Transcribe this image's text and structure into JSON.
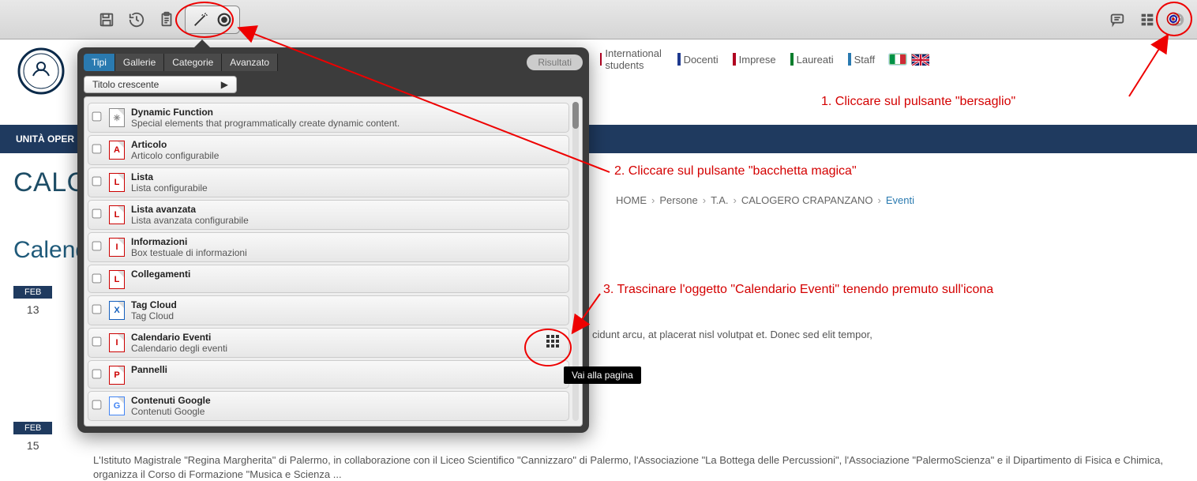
{
  "toolbar": {
    "icons": [
      "save",
      "history",
      "clipboard",
      "wand",
      "publish",
      "comment",
      "structure",
      "close",
      "target"
    ]
  },
  "nav": {
    "items": [
      {
        "label": "International students",
        "color": "#b00020"
      },
      {
        "label": "Docenti",
        "color": "#1f3a8f"
      },
      {
        "label": "Imprese",
        "color": "#b00020"
      },
      {
        "label": "Laureati",
        "color": "#0a7d2c"
      },
      {
        "label": "Staff",
        "color": "#2a7ab0"
      }
    ]
  },
  "blue_bar": "UNITÀ OPER",
  "big_title": "CALOG",
  "calendar_title": "Calenda",
  "feb_label": "FEB",
  "feb_days": [
    "13",
    "15"
  ],
  "breadcrumbs": [
    "HOME",
    "Persone",
    "T.A.",
    "CALOGERO CRAPANZANO"
  ],
  "breadcrumbs_current": "Eventi",
  "paragraph": "cidunt arcu, at placerat nisl volutpat et. Donec sed elit tempor,",
  "bottom_paragraph": "L'Istituto Magistrale \"Regina Margherita\" di Palermo, in collaborazione con il Liceo Scientifico \"Cannizzaro\" di Palermo, l'Associazione \"La Bottega delle Percussioni\", l'Associazione \"PalermoScienza\" e il Dipartimento di Fisica e Chimica, organizza il Corso di Formazione \"Musica e Scienza ...",
  "flyout": {
    "tabs": [
      "Tipi",
      "Gallerie",
      "Categorie",
      "Avanzato"
    ],
    "results": "Risultati",
    "sort": "Titolo crescente",
    "rows": [
      {
        "icon": "✳",
        "title": "Dynamic Function",
        "desc": "Special elements that programmatically create dynamic content.",
        "i": "#888"
      },
      {
        "icon": "A",
        "title": "Articolo",
        "desc": "Articolo configurabile",
        "i": "#cc0000"
      },
      {
        "icon": "L",
        "title": "Lista",
        "desc": "Lista configurabile",
        "i": "#cc0000"
      },
      {
        "icon": "L",
        "title": "Lista avanzata",
        "desc": "Lista avanzata configurabile",
        "i": "#cc0000"
      },
      {
        "icon": "I",
        "title": "Informazioni",
        "desc": "Box testuale di informazioni",
        "i": "#cc0000"
      },
      {
        "icon": "L",
        "title": "Collegamenti",
        "desc": "",
        "i": "#cc0000"
      },
      {
        "icon": "X",
        "title": "Tag Cloud",
        "desc": "Tag Cloud",
        "i": "#1560bd"
      },
      {
        "icon": "I",
        "title": "Calendario Eventi",
        "desc": "Calendario degli eventi",
        "i": "#cc0000",
        "drag": true
      },
      {
        "icon": "P",
        "title": "Pannelli",
        "desc": "",
        "i": "#cc0000"
      },
      {
        "icon": "G",
        "title": "Contenuti Google",
        "desc": "Contenuti Google",
        "i": "#4285F4"
      }
    ]
  },
  "tooltip": "Vai alla pagina",
  "annotations": {
    "a1": "1. Cliccare sul pulsante \"bersaglio\"",
    "a2": "2. Cliccare sul pulsante \"bacchetta magica\"",
    "a3": "3. Trascinare l'oggetto \"Calendario Eventi\" tenendo premuto sull'icona"
  }
}
